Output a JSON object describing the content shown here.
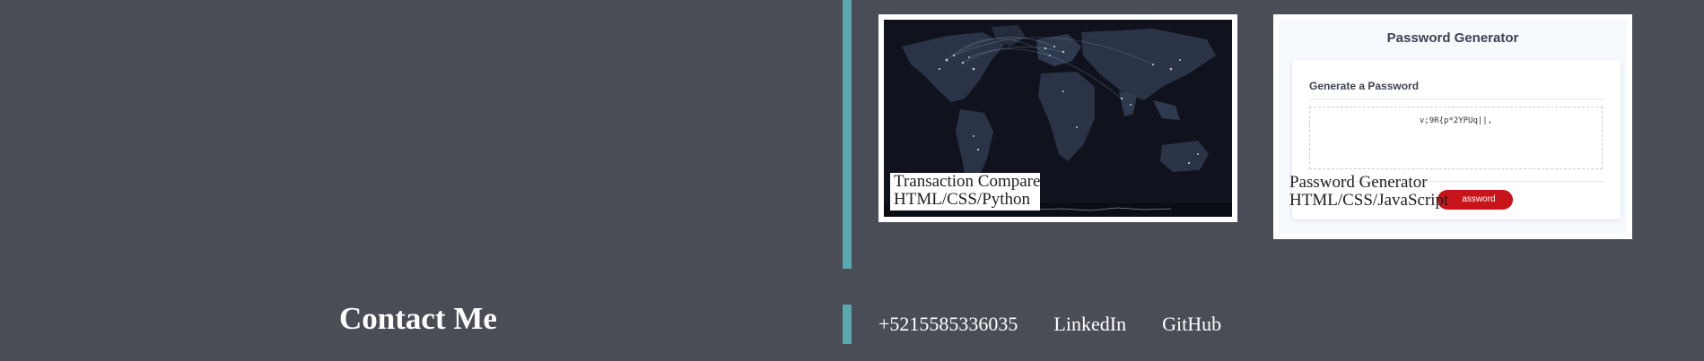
{
  "projects": [
    {
      "name": "Transaction Compare",
      "stack": "HTML/CSS/Python",
      "thumbnail": "world-map-screenshot"
    },
    {
      "name": "Password Generator",
      "stack": "HTML/CSS/JavaScript",
      "thumbnail": "password-generator-screenshot",
      "screenshot": {
        "title": "Password Generator",
        "subtitle": "Generate a Password",
        "password": "v;9R{p*2YPUq||,",
        "button_label": "assword"
      }
    }
  ],
  "contact": {
    "title": "Contact Me",
    "phone": "+5215585336035",
    "linkedin": "LinkedIn",
    "github": "GitHub"
  },
  "colors": {
    "background": "#4a4d55",
    "accent": "#59a9ae",
    "button": "#c8151b"
  }
}
